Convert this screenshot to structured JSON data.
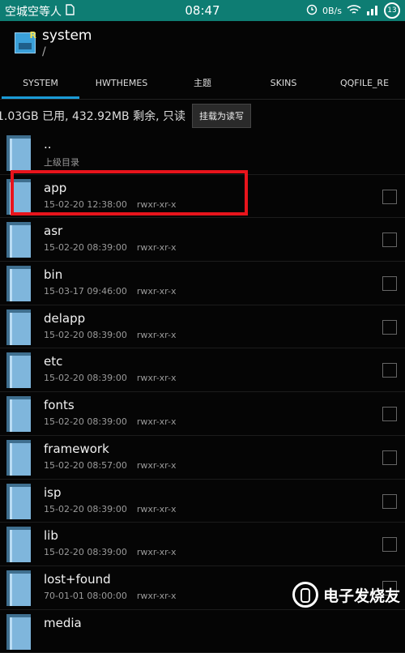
{
  "statusbar": {
    "carrier": "空城空等人",
    "time": "08:47",
    "right_small": "0B/s",
    "battery": "13"
  },
  "header": {
    "title": "system",
    "path": "/"
  },
  "tabs": [
    {
      "label": "SYSTEM"
    },
    {
      "label": "HWTHEMES"
    },
    {
      "label": "主题"
    },
    {
      "label": "SKINS"
    },
    {
      "label": "QQFILE_RE"
    }
  ],
  "storage": {
    "text": "1.03GB 已用, 432.92MB 剩余, 只读",
    "mount_button": "挂载为读写"
  },
  "files": [
    {
      "name": "..",
      "meta": "上级目录",
      "perm": ""
    },
    {
      "name": "app",
      "meta": "15-02-20 12:38:00",
      "perm": "rwxr-xr-x"
    },
    {
      "name": "asr",
      "meta": "15-02-20 08:39:00",
      "perm": "rwxr-xr-x"
    },
    {
      "name": "bin",
      "meta": "15-03-17 09:46:00",
      "perm": "rwxr-xr-x"
    },
    {
      "name": "delapp",
      "meta": "15-02-20 08:39:00",
      "perm": "rwxr-xr-x"
    },
    {
      "name": "etc",
      "meta": "15-02-20 08:39:00",
      "perm": "rwxr-xr-x"
    },
    {
      "name": "fonts",
      "meta": "15-02-20 08:39:00",
      "perm": "rwxr-xr-x"
    },
    {
      "name": "framework",
      "meta": "15-02-20 08:57:00",
      "perm": "rwxr-xr-x"
    },
    {
      "name": "isp",
      "meta": "15-02-20 08:39:00",
      "perm": "rwxr-xr-x"
    },
    {
      "name": "lib",
      "meta": "15-02-20 08:39:00",
      "perm": "rwxr-xr-x"
    },
    {
      "name": "lost+found",
      "meta": "70-01-01 08:00:00",
      "perm": "rwxr-xr-x"
    },
    {
      "name": "media",
      "meta": "",
      "perm": ""
    }
  ],
  "watermark": {
    "text": "电子发烧友",
    "logo_icon": "logo-icon"
  },
  "colors": {
    "statusbar": "#0e7d73",
    "tab_indicator": "#1a9bd7",
    "highlight": "#e8141c",
    "folder": "#7fb6dc"
  }
}
